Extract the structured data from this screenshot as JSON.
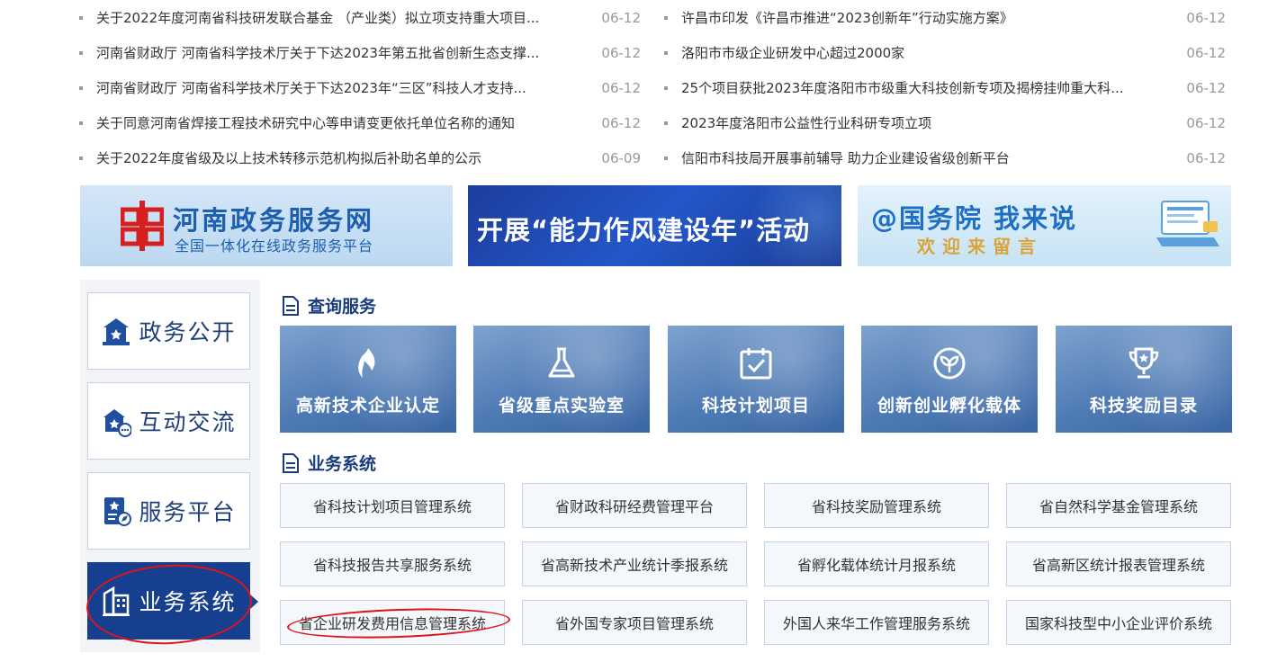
{
  "news_left": [
    {
      "title": "关于2022年度河南省科技研发联合基金 （产业类）拟立项支持重大项目...",
      "date": "06-12"
    },
    {
      "title": "河南省财政厅 河南省科学技术厅关于下达2023年第五批省创新生态支撑...",
      "date": "06-12"
    },
    {
      "title": "河南省财政厅 河南省科学技术厅关于下达2023年“三区”科技人才支持...",
      "date": "06-12"
    },
    {
      "title": "关于同意河南省焊接工程技术研究中心等申请变更依托单位名称的通知",
      "date": "06-12"
    },
    {
      "title": "关于2022年度省级及以上技术转移示范机构拟后补助名单的公示",
      "date": "06-09"
    }
  ],
  "news_right": [
    {
      "title": "许昌市印发《许昌市推进“2023创新年”行动实施方案》",
      "date": "06-12"
    },
    {
      "title": "洛阳市市级企业研发中心超过2000家",
      "date": "06-12"
    },
    {
      "title": "25个项目获批2023年度洛阳市市级重大科技创新专项及揭榜挂帅重大科...",
      "date": "06-12"
    },
    {
      "title": "2023年度洛阳市公益性行业科研专项立项",
      "date": "06-12"
    },
    {
      "title": "信阳市科技局开展事前辅导 助力企业建设省级创新平台",
      "date": "06-12"
    }
  ],
  "banners": {
    "gov_service_main": "河南政务服务网",
    "gov_service_sub": "全国一体化在线政务服务平台",
    "campaign": "开展“能力作风建设年”活动",
    "state_council_main": "@国务院 我来说",
    "state_council_sub": "欢迎来留言"
  },
  "side_nav": [
    {
      "label": "政务公开",
      "icon": "building-star-icon"
    },
    {
      "label": "互动交流",
      "icon": "chat-building-icon"
    },
    {
      "label": "服务平台",
      "icon": "document-compass-icon"
    },
    {
      "label": "业务系统",
      "icon": "buildings-icon",
      "active": true
    }
  ],
  "sections": {
    "query_title": "查询服务",
    "system_title": "业务系统"
  },
  "tiles": [
    {
      "label": "高新技术企业认定",
      "icon": "flame-icon"
    },
    {
      "label": "省级重点实验室",
      "icon": "flask-icon"
    },
    {
      "label": "科技计划项目",
      "icon": "calendar-check-icon"
    },
    {
      "label": "创新创业孵化载体",
      "icon": "sprout-icon"
    },
    {
      "label": "科技奖励目录",
      "icon": "trophy-icon"
    }
  ],
  "systems": [
    "省科技计划项目管理系统",
    "省财政科研经费管理平台",
    "省科技奖励管理系统",
    "省自然科学基金管理系统",
    "省科技报告共享服务系统",
    "省高新技术产业统计季报系统",
    "省孵化载体统计月报系统",
    "省高新区统计报表管理系统",
    "省企业研发费用信息管理系统",
    "省外国专家项目管理系统",
    "外国人来华工作管理服务系统",
    "国家科技型中小企业评价系统"
  ],
  "colors": {
    "navy": "#16408f",
    "title_blue": "#1a3c7e",
    "annotation_red": "#e0131b"
  }
}
